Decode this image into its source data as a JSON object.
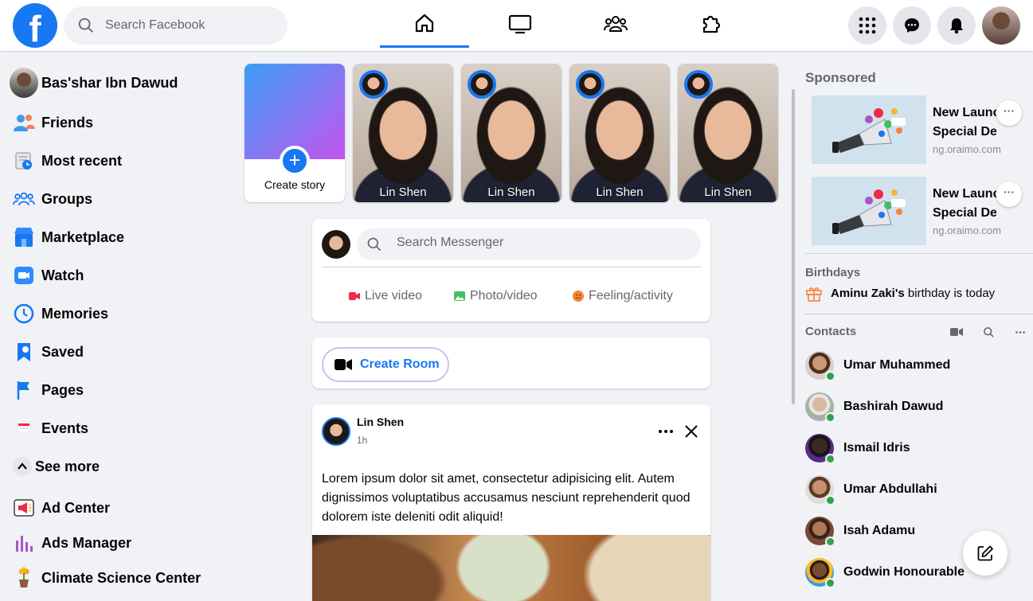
{
  "app": {
    "logo_letter": "f",
    "brand_color": "#1877f2"
  },
  "search": {
    "placeholder": "Search Facebook"
  },
  "nav_tabs": [
    {
      "icon": "home-icon",
      "active": true
    },
    {
      "icon": "watch-icon",
      "active": false
    },
    {
      "icon": "groups-icon",
      "active": false
    },
    {
      "icon": "gaming-icon",
      "active": false
    }
  ],
  "header_actions": [
    "menu-grid-icon",
    "messenger-icon",
    "notifications-icon"
  ],
  "sidebar": {
    "profile_name": "Bas'shar Ibn Dawud",
    "items": [
      {
        "label": "Friends",
        "icon": "friends-icon"
      },
      {
        "label": "Most recent",
        "icon": "most-recent-icon"
      },
      {
        "label": "Groups",
        "icon": "groups-icon"
      },
      {
        "label": "Marketplace",
        "icon": "marketplace-icon"
      },
      {
        "label": "Watch",
        "icon": "watch-icon"
      },
      {
        "label": "Memories",
        "icon": "memories-icon"
      },
      {
        "label": "Saved",
        "icon": "saved-icon"
      },
      {
        "label": "Pages",
        "icon": "pages-icon"
      },
      {
        "label": "Events",
        "icon": "events-icon"
      }
    ],
    "see_more": "See more",
    "shortcuts": [
      {
        "label": "Ad Center",
        "icon": "ad-center-icon"
      },
      {
        "label": "Ads Manager",
        "icon": "ads-manager-icon"
      },
      {
        "label": "Climate Science Center",
        "icon": "climate-icon"
      }
    ]
  },
  "stories": {
    "create_label": "Create story",
    "items": [
      {
        "name": "Lin Shen"
      },
      {
        "name": "Lin Shen"
      },
      {
        "name": "Lin Shen"
      },
      {
        "name": "Lin Shen"
      }
    ]
  },
  "composer": {
    "placeholder": "Search Messenger",
    "actions": [
      {
        "label": "Live video",
        "icon": "live-video-icon",
        "color": "#f02849"
      },
      {
        "label": "Photo/video",
        "icon": "photo-icon",
        "color": "#45bd62"
      },
      {
        "label": "Feeling/activity",
        "icon": "feeling-icon",
        "color": "#f7b928"
      }
    ]
  },
  "room": {
    "label": "Create Room"
  },
  "post": {
    "author": "Lin Shen",
    "time": "1h",
    "text": "Lorem ipsum dolor sit amet, consectetur adipisicing elit. Autem dignissimos voluptatibus accusamus nesciunt reprehenderit quod dolorem iste deleniti odit aliquid!"
  },
  "right": {
    "sponsored_title": "Sponsored",
    "ads": [
      {
        "title_line1": "New Launc",
        "title_line2": "Special Deal",
        "domain": "ng.oraimo.com"
      },
      {
        "title_line1": "New Launc",
        "title_line2": "Special Deal",
        "domain": "ng.oraimo.com"
      }
    ],
    "birthdays_title": "Birthdays",
    "birthday_name": "Aminu Zaki's",
    "birthday_rest": " birthday is today",
    "contacts_title": "Contacts",
    "contacts": [
      {
        "name": "Umar Muhammed",
        "online": true
      },
      {
        "name": "Bashirah Dawud",
        "online": true
      },
      {
        "name": "Ismail Idris",
        "online": true
      },
      {
        "name": "Umar Abdullahi",
        "online": true
      },
      {
        "name": "Isah Adamu",
        "online": true
      },
      {
        "name": "Godwin Honourable",
        "online": true
      }
    ]
  }
}
